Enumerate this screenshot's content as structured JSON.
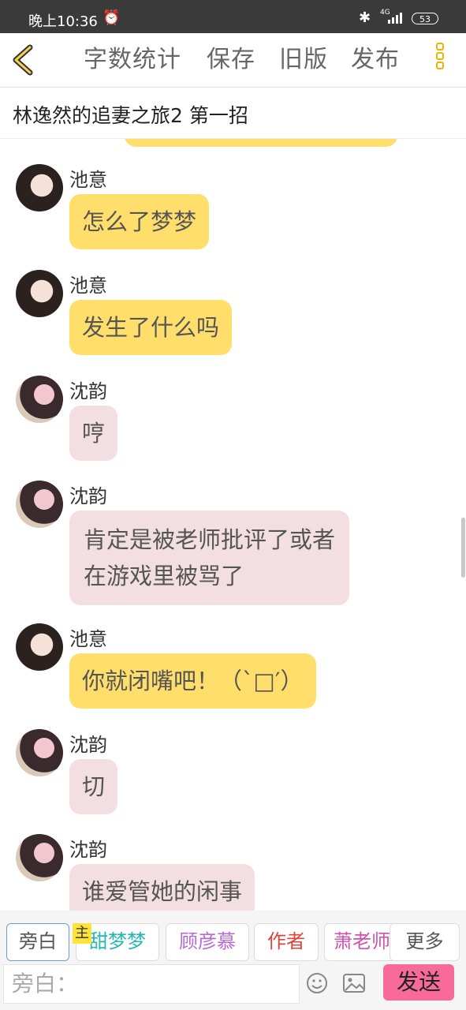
{
  "status_bar": {
    "time": "晚上10:36",
    "network": "4G",
    "battery": "53"
  },
  "nav": {
    "items": [
      "字数统计",
      "保存",
      "旧版",
      "发布"
    ]
  },
  "title": "林逸然的追妻之旅2 第一招",
  "messages": [
    {
      "sender": "池意",
      "text_lines": [
        "怎么了梦梦"
      ],
      "style": "yellow"
    },
    {
      "sender": "池意",
      "text_lines": [
        "发生了什么吗"
      ],
      "style": "yellow"
    },
    {
      "sender": "沈韵",
      "text_lines": [
        "哼"
      ],
      "style": "pink"
    },
    {
      "sender": "沈韵",
      "text_lines": [
        "肯定是被老师批评了或者",
        "在游戏里被骂了"
      ],
      "style": "pink"
    },
    {
      "sender": "池意",
      "text_lines": [
        "你就闭嘴吧！（`□′）"
      ],
      "style": "yellow"
    },
    {
      "sender": "沈韵",
      "text_lines": [
        "切"
      ],
      "style": "pink"
    },
    {
      "sender": "沈韵",
      "text_lines": [
        "谁爱管她的闲事"
      ],
      "style": "pink"
    }
  ],
  "roles": {
    "narration": "旁白",
    "main_tag": "主",
    "tian": "甜梦梦",
    "gu": "顾彦慕",
    "author": "作者",
    "xiao": "萧老师",
    "more": "更多"
  },
  "colors": {
    "tian": "#27b7b3",
    "gu": "#b56bd0",
    "author": "#e0433a",
    "xiao": "#d24fb0",
    "yellow_bubble": "#ffde6b",
    "pink_bubble": "#f3dfe1",
    "send": "#f76a9a"
  },
  "input": {
    "prefix": "旁白：",
    "send_label": "发送"
  }
}
